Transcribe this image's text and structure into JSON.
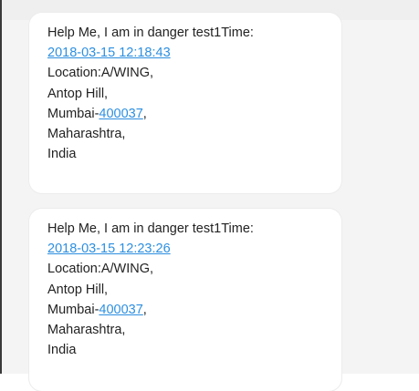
{
  "messages": [
    {
      "header": "Help Me, I am in danger test1Time:",
      "time": "2018-03-15 12:18:43",
      "location": "Location:A/WING,",
      "area": "Antop Hill,",
      "city_prefix": "Mumbai-",
      "pincode": "400037",
      "city_suffix": ",",
      "state": "Maharashtra,",
      "country": "India"
    },
    {
      "header": "Help Me, I am in danger test1Time:",
      "time": "2018-03-15 12:23:26",
      "location": "Location:A/WING,",
      "area": "Antop Hill,",
      "city_prefix": "Mumbai-",
      "pincode": "400037",
      "city_suffix": ",",
      "state": "Maharashtra,",
      "country": "India"
    }
  ],
  "colors": {
    "link": "#2d8fe0",
    "text": "#222222",
    "bubble": "#ffffff",
    "background": "#f4f4f5"
  }
}
